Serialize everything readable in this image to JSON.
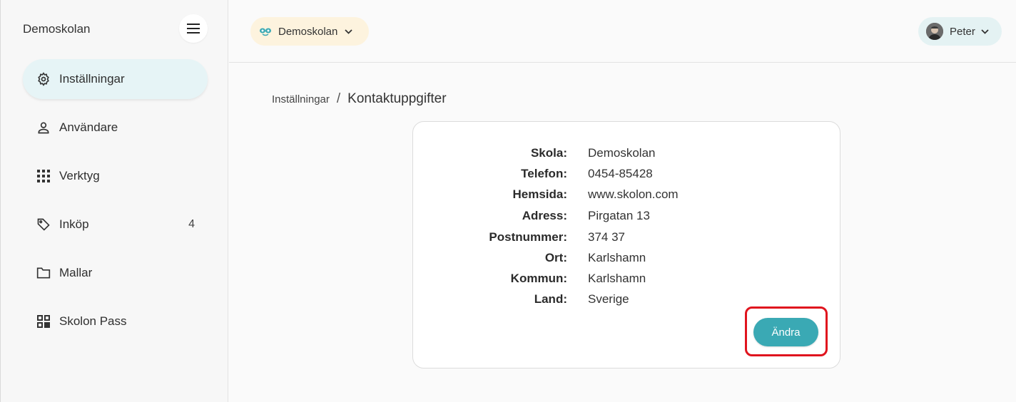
{
  "sidebar": {
    "school_name": "Demoskolan",
    "menu_icon": "hamburger-icon",
    "items": [
      {
        "label": "Inställningar",
        "icon": "gear-icon",
        "active": true
      },
      {
        "label": "Användare",
        "icon": "user-icon"
      },
      {
        "label": "Verktyg",
        "icon": "grid-icon"
      },
      {
        "label": "Inköp",
        "icon": "tag-icon",
        "badge": "4"
      },
      {
        "label": "Mallar",
        "icon": "folder-icon"
      },
      {
        "label": "Skolon Pass",
        "icon": "qr-icon"
      }
    ]
  },
  "topbar": {
    "org_label": "Demoskolan",
    "user_label": "Peter"
  },
  "breadcrumb": {
    "parent": "Inställningar",
    "separator": "/",
    "current": "Kontaktuppgifter"
  },
  "contact": [
    {
      "label": "Skola:",
      "value": "Demoskolan"
    },
    {
      "label": "Telefon:",
      "value": "0454-85428"
    },
    {
      "label": "Hemsida:",
      "value": "www.skolon.com"
    },
    {
      "label": "Adress:",
      "value": "Pirgatan 13"
    },
    {
      "label": "Postnummer:",
      "value": "374 37"
    },
    {
      "label": "Ort:",
      "value": "Karlshamn"
    },
    {
      "label": "Kommun:",
      "value": "Karlshamn"
    },
    {
      "label": "Land:",
      "value": "Sverige"
    }
  ],
  "edit_button": "Ändra",
  "colors": {
    "accent": "#3aa9b4",
    "active_nav": "#e6f4f6",
    "org_pill": "#fdf3de",
    "user_pill": "#e4f2f3",
    "highlight": "#e0141e"
  }
}
